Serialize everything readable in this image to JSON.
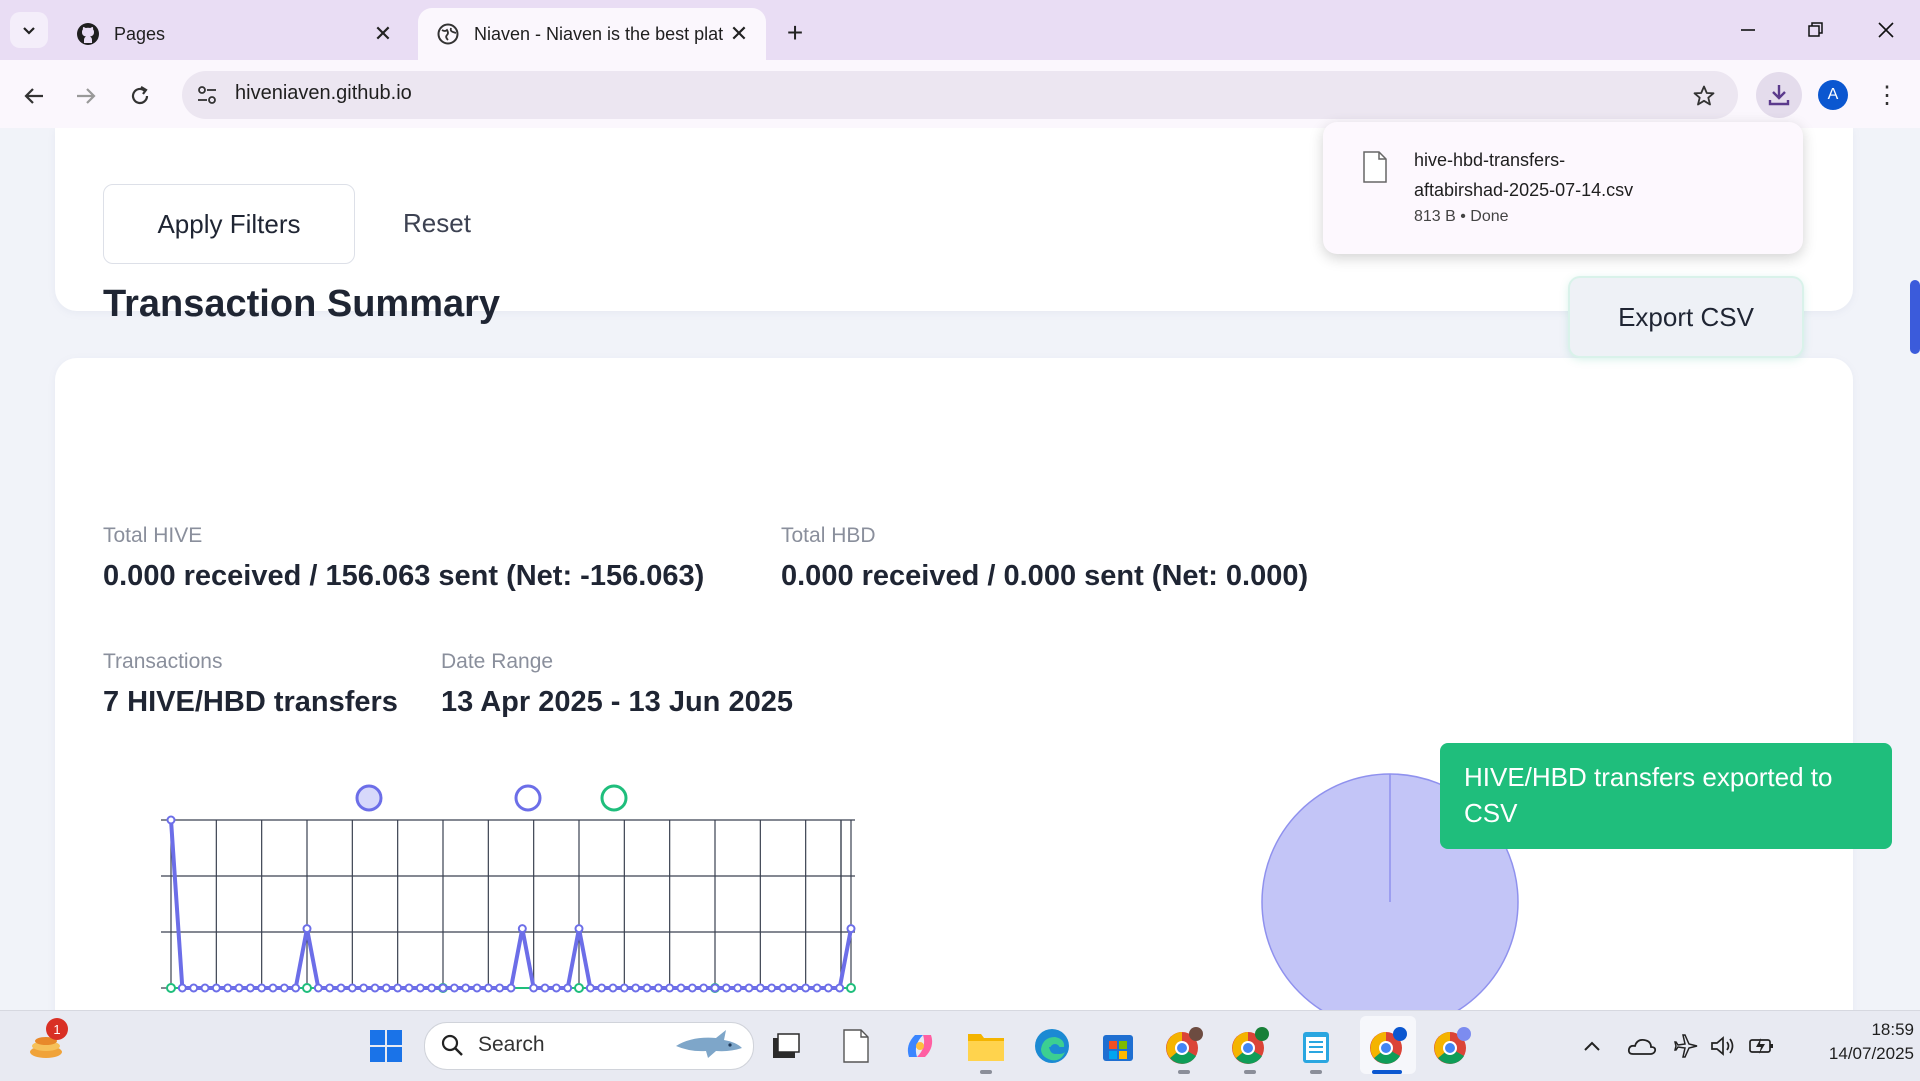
{
  "browser": {
    "tabs": [
      {
        "title": "Pages",
        "favicon": "github-icon"
      },
      {
        "title": "Niaven - Niaven is the best plat",
        "favicon": "globe-icon",
        "active": true
      }
    ],
    "url": "hiveniaven.github.io",
    "profile_initial": "A"
  },
  "download": {
    "filename_line1": "hive-hbd-transfers-",
    "filename_line2": "aftabirshad-2025-07-14.csv",
    "status": "813 B • Done"
  },
  "filters": {
    "apply_label": "Apply Filters",
    "reset_label": "Reset"
  },
  "summary": {
    "title": "Transaction Summary",
    "export_label": "Export CSV",
    "total_hive_label": "Total HIVE",
    "total_hive_value": "0.000 received / 156.063 sent (Net: -156.063)",
    "total_hbd_label": "Total HBD",
    "total_hbd_value": "0.000 received / 0.000 sent (Net: 0.000)",
    "transactions_label": "Transactions",
    "transactions_value": "7 HIVE/HBD transfers",
    "date_range_label": "Date Range",
    "date_range_value": "13 Apr 2025 - 13 Jun 2025"
  },
  "chart_data": [
    {
      "type": "line",
      "series": [
        {
          "color": "#6c6ee8",
          "values": [
            150,
            0,
            0,
            0,
            0,
            0,
            0,
            0,
            0,
            0,
            0,
            0,
            0,
            0,
            0,
            0,
            0,
            0,
            0,
            0,
            0,
            0,
            0,
            0,
            0,
            0,
            0,
            0,
            0,
            0,
            0,
            0,
            0,
            0,
            0,
            0,
            0,
            0,
            0,
            0,
            0,
            0,
            0,
            0,
            0,
            0,
            0,
            0,
            0,
            0,
            0,
            0,
            0,
            0,
            0,
            0,
            0,
            0,
            0,
            0,
            0
          ]
        },
        {
          "color": "#1fbe7c",
          "values": [
            0,
            0,
            0,
            0,
            0,
            0,
            0,
            0,
            0,
            0,
            0,
            0,
            0,
            0,
            0,
            0,
            0,
            0,
            0,
            0,
            0,
            0,
            0,
            0,
            0,
            0,
            0,
            0,
            0,
            0,
            0,
            0,
            0,
            0,
            0,
            0,
            0,
            0,
            0,
            0,
            0,
            0,
            0,
            0,
            0,
            0,
            0,
            0,
            0,
            0,
            0,
            0,
            0,
            0,
            0,
            0,
            0,
            0,
            0,
            0,
            0
          ]
        }
      ],
      "spikes": [
        {
          "index": 0,
          "value": 150
        },
        {
          "index": 12,
          "value": 53
        },
        {
          "index": 31,
          "value": 53
        },
        {
          "index": 36,
          "value": 53
        },
        {
          "index": 60,
          "value": 53
        }
      ],
      "legend_colors": [
        "#d7d8fb",
        "#6c6ee8",
        "#1fbe7c"
      ],
      "ylim": [
        0,
        150
      ],
      "grid": true
    },
    {
      "type": "pie",
      "slices": [
        {
          "value": 156.063,
          "color": "#c3c5f7"
        }
      ]
    }
  ],
  "toast": {
    "message": "HIVE/HBD transfers exported to CSV"
  },
  "taskbar": {
    "search_label": "Search",
    "time": "18:59",
    "date": "14/07/2025",
    "notification_count": "1"
  }
}
